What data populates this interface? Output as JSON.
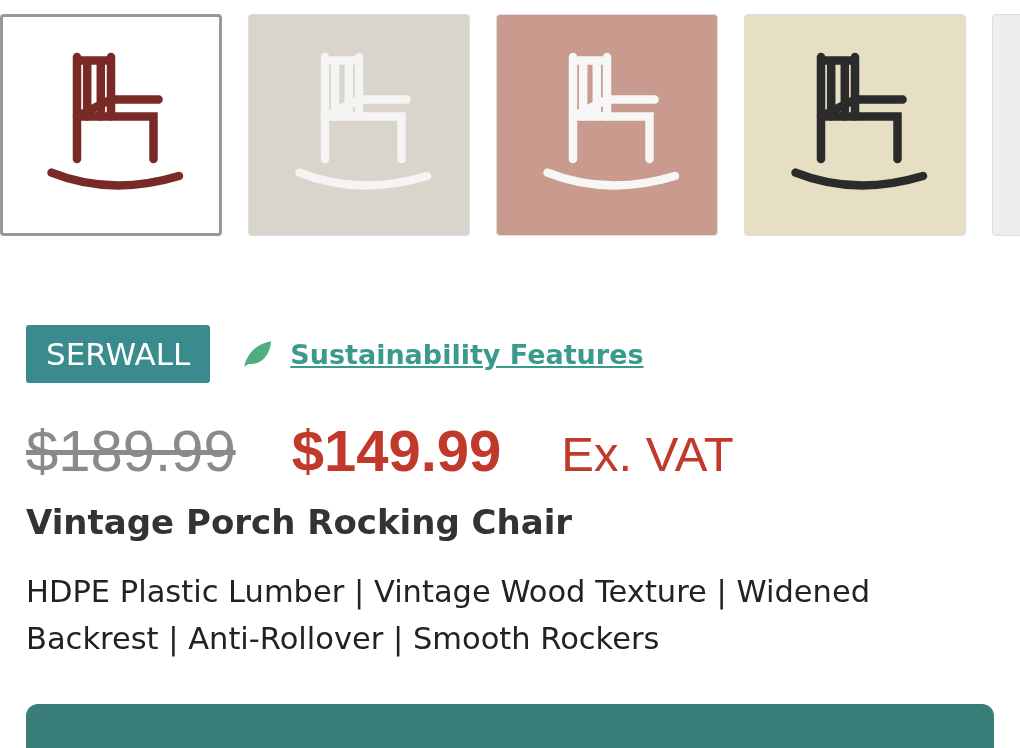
{
  "gallery": [
    {
      "selected": true
    },
    {
      "selected": false
    },
    {
      "selected": false
    },
    {
      "selected": false
    },
    {
      "selected": false
    }
  ],
  "brand": "SERWALL",
  "sustainability_link": "Sustainability Features",
  "price": {
    "original": "$189.99",
    "current": "$149.99",
    "tax_note": "Ex. VAT"
  },
  "title": "Vintage Porch Rocking Chair",
  "description": "HDPE Plastic Lumber | Vintage Wood Texture | Widened Backrest | Anti-Rollover | Smooth Rockers"
}
